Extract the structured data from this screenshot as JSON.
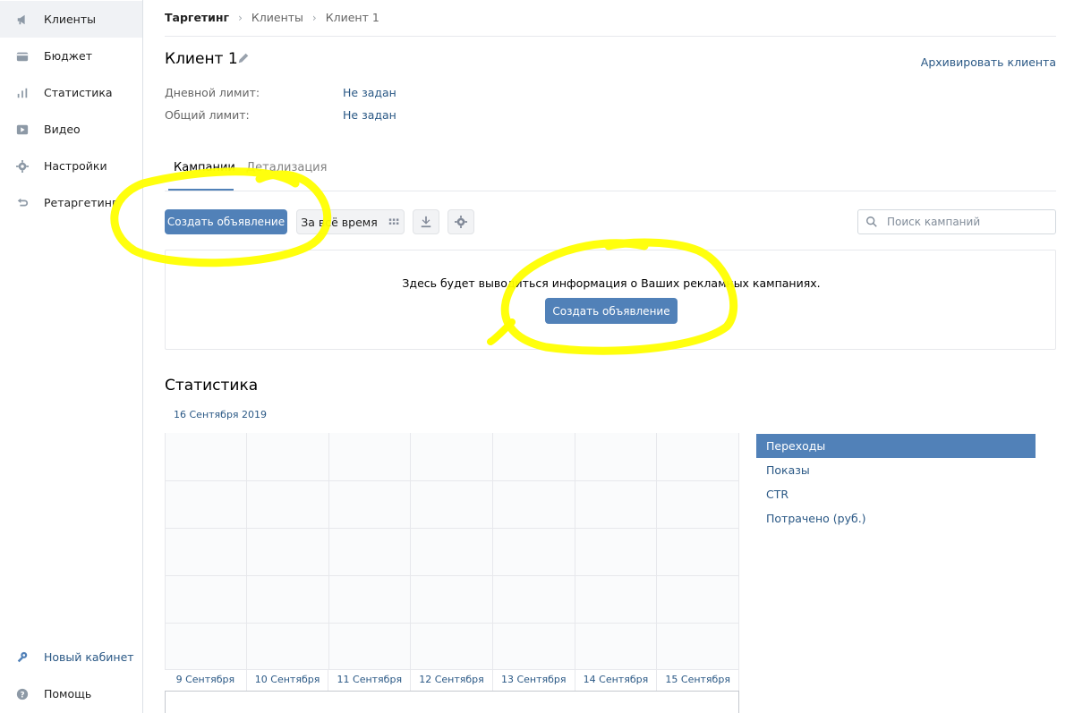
{
  "sidebar": {
    "items": [
      {
        "label": "Клиенты",
        "icon": "megaphone-icon"
      },
      {
        "label": "Бюджет",
        "icon": "wallet-icon"
      },
      {
        "label": "Статистика",
        "icon": "bar-chart-icon"
      },
      {
        "label": "Видео",
        "icon": "play-icon"
      },
      {
        "label": "Настройки",
        "icon": "gear-icon"
      },
      {
        "label": "Ретаргетинг",
        "icon": "retarget-arrow-icon"
      }
    ],
    "bottom": [
      {
        "label": "Новый кабинет",
        "icon": "wrench-icon"
      },
      {
        "label": "Помощь",
        "icon": "help-icon"
      }
    ]
  },
  "breadcrumb": [
    "Таргетинг",
    "Клиенты",
    "Клиент 1"
  ],
  "client": {
    "title": "Клиент 1",
    "archive": "Архивировать клиента",
    "daily_limit_label": "Дневной лимит:",
    "daily_limit_value": "Не задан",
    "total_limit_label": "Общий лимит:",
    "total_limit_value": "Не задан"
  },
  "tabs": [
    "Кампании",
    "Детализация"
  ],
  "toolbar": {
    "create_button": "Создать объявление",
    "period_button": "За всё время",
    "search_placeholder": "Поиск кампаний"
  },
  "empty": {
    "text": "Здесь будет выводиться информация о Ваших рекламных кампаниях.",
    "button": "Создать объявление"
  },
  "stats": {
    "title": "Статистика",
    "date": "16 Сентября 2019",
    "xlabels": [
      "9 Сентября",
      "10 Сентября",
      "11 Сентября",
      "12 Сентября",
      "13 Сентября",
      "14 Сентября",
      "15 Сентября"
    ],
    "metrics": [
      "Переходы",
      "Показы",
      "CTR",
      "Потрачено (руб.)"
    ]
  },
  "colors": {
    "accent": "#5181b8",
    "link": "#2a5885",
    "highlight": "#ffff00"
  }
}
